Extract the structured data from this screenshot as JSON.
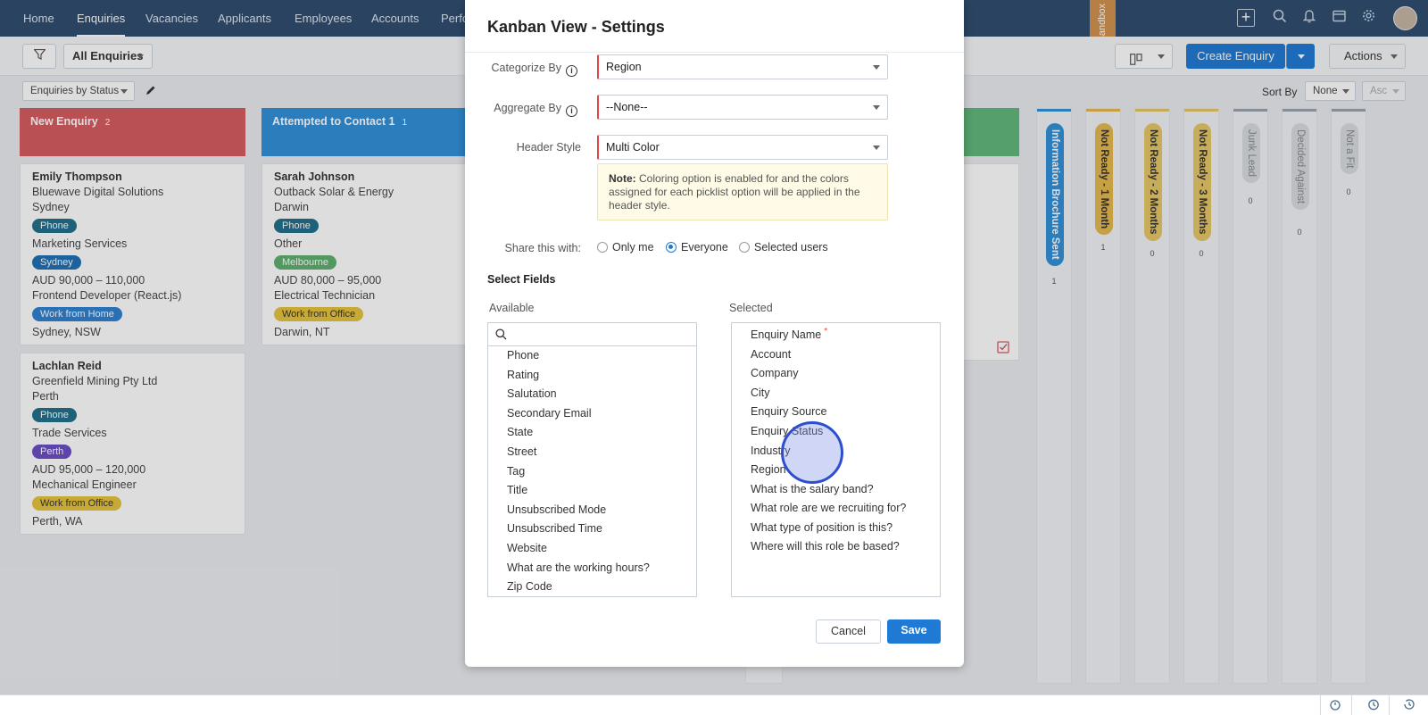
{
  "nav": {
    "items": [
      "Home",
      "Enquiries",
      "Vacancies",
      "Applicants",
      "Employees",
      "Accounts",
      "Perfo"
    ],
    "active": "Enquiries",
    "sandbox": "Sandbox"
  },
  "toolbar": {
    "view_select": "All Enquiries",
    "create_button": "Create Enquiry",
    "actions_button": "Actions",
    "board_select": "Enquiries by Status",
    "sort_label": "Sort By",
    "sort_value": "None",
    "sort_order": "Asc"
  },
  "columns": [
    {
      "title": "New Enquiry",
      "count": "2",
      "color": "#d45a5e",
      "cards": [
        {
          "name": "Emily Thompson",
          "company": "Bluewave Digital Solutions",
          "city": "Sydney",
          "source": "Phone",
          "industry": "Marketing Services",
          "region": "Sydney",
          "salary": "AUD 90,000 – 110,000",
          "role": "Frontend Developer (React.js)",
          "position": "Work from Home",
          "location": "Sydney, NSW"
        },
        {
          "name": "Lachlan Reid",
          "company": "Greenfield Mining Pty Ltd",
          "city": "Perth",
          "source": "Phone",
          "industry": "Trade Services",
          "region": "Perth",
          "salary": "AUD 95,000 – 120,000",
          "role": "Mechanical Engineer",
          "position": "Work from Office",
          "location": "Perth, WA"
        }
      ]
    },
    {
      "title": "Attempted to Contact 1",
      "count": "1",
      "color": "#2f8fd9",
      "cards": [
        {
          "name": "Sarah Johnson",
          "company": "Outback Solar & Energy",
          "city": "Darwin",
          "source": "Phone",
          "industry": "Other",
          "region": "Melbourne",
          "salary": "AUD 80,000 – 95,000",
          "role": "Electrical Technician",
          "position": "Work from Office",
          "location": "Darwin, NT"
        }
      ]
    }
  ],
  "collapsed_columns": [
    {
      "title": "Information Brochure Sent",
      "count": "1",
      "color": "#2f8fd9"
    },
    {
      "title": "Not Ready - 1 Month",
      "count": "1",
      "color": "#e6b84a"
    },
    {
      "title": "Not Ready - 2 Months",
      "count": "0",
      "color": "#e6c766"
    },
    {
      "title": "Not Ready - 3 Months",
      "count": "0",
      "color": "#e6c766"
    },
    {
      "title": "Junk Lead",
      "count": "0",
      "color": "#9aa3ad"
    },
    {
      "title": "Decided Against",
      "count": "0",
      "color": "#9aa3ad"
    },
    {
      "title": "Not a Fit",
      "count": "0",
      "color": "#9aa3ad"
    }
  ],
  "modal": {
    "title": "Kanban View - Settings",
    "categorize_label": "Categorize By",
    "categorize_value": "Region",
    "aggregate_label": "Aggregate By",
    "aggregate_value": "--None--",
    "header_style_label": "Header Style",
    "header_style_value": "Multi Color",
    "note_prefix": "Note:",
    "note_text": "Coloring option is enabled for and the colors assigned for each picklist option will be applied in the header style.",
    "share_label": "Share this with:",
    "share_options": [
      "Only me",
      "Everyone",
      "Selected users"
    ],
    "share_selected": "Everyone",
    "select_fields_label": "Select Fields",
    "available_label": "Available",
    "selected_label": "Selected",
    "available_fields": [
      "Phone",
      "Rating",
      "Salutation",
      "Secondary Email",
      "State",
      "Street",
      "Tag",
      "Title",
      "Unsubscribed Mode",
      "Unsubscribed Time",
      "Website",
      "What are the working hours?",
      "Zip Code"
    ],
    "selected_fields": [
      "Enquiry Name",
      "Account",
      "Company",
      "City",
      "Enquiry Source",
      "Enquiry Status",
      "Industry",
      "Region",
      "What is the salary band?",
      "What role are we recruiting for?",
      "What type of position is this?",
      "Where will this role be based?"
    ],
    "required_mark": "*",
    "cancel_button": "Cancel",
    "save_button": "Save"
  },
  "colors": {
    "nav_bg": "#2c4a6e",
    "primary": "#1e7ad4",
    "pill_phone": "#1f6f8b",
    "pill_region": "#1f6fb4",
    "pill_perth": "#6a4bc4",
    "pill_melbourne": "#5fae6e",
    "pill_wfh": "#2d7fd0",
    "pill_wfo": "#e6c23a"
  }
}
